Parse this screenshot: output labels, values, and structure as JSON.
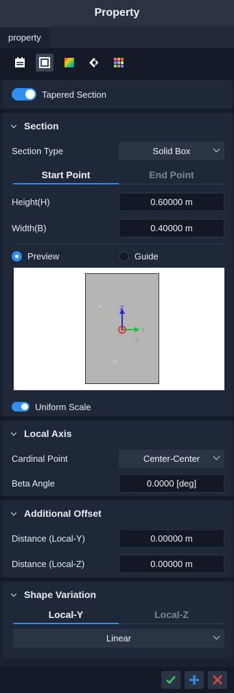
{
  "window": {
    "title": "Property"
  },
  "tabs": [
    {
      "label": "property"
    }
  ],
  "toolbar": {
    "icons": [
      "calendar-icon",
      "frame-icon",
      "color-map-icon",
      "arrow-icon",
      "palette-grid-icon"
    ]
  },
  "tapered": {
    "label": "Tapered Section",
    "enabled": true
  },
  "section": {
    "title": "Section",
    "type_label": "Section Type",
    "type_value": "Solid Box",
    "tabs": [
      "Start Point",
      "End Point"
    ],
    "active_tab": "Start Point",
    "height_label": "Height(H)",
    "height_value": "0.60000 m",
    "width_label": "Width(B)",
    "width_value": "0.40000 m",
    "view_options": [
      "Preview",
      "Guide"
    ],
    "selected_view": "Preview",
    "uniform_scale_label": "Uniform Scale",
    "uniform_scale_enabled": true,
    "axis_labels": {
      "z": "Z",
      "y": "Y"
    }
  },
  "local_axis": {
    "title": "Local Axis",
    "cardinal_label": "Cardinal Point",
    "cardinal_value": "Center-Center",
    "beta_label": "Beta Angle",
    "beta_value": "0.0000 [deg]"
  },
  "offset": {
    "title": "Additional Offset",
    "y_label": "Distance (Local-Y)",
    "y_value": "0.00000 m",
    "z_label": "Distance (Local-Z)",
    "z_value": "0.00000 m"
  },
  "shape_variation": {
    "title": "Shape Variation",
    "tabs": [
      "Local-Y",
      "Local-Z"
    ],
    "active_tab": "Local-Y",
    "type_value": "Linear"
  },
  "colors": {
    "accent": "#2f8ef0",
    "ok": "#3cc45a",
    "add": "#2f8ef0",
    "cancel": "#e04848"
  }
}
